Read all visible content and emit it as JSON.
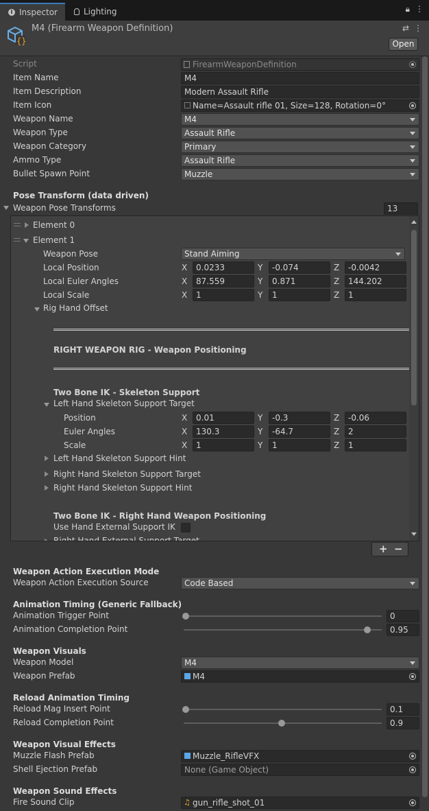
{
  "tabs": [
    {
      "label": "Inspector",
      "icon": "info-icon"
    },
    {
      "label": "Lighting",
      "icon": "bulb-icon"
    }
  ],
  "header": {
    "title": "M4 (Firearm Weapon Definition)",
    "open_label": "Open"
  },
  "fields": {
    "script": {
      "label": "Script",
      "value": "FirearmWeaponDefinition"
    },
    "item_name": {
      "label": "Item Name",
      "value": "M4"
    },
    "item_description": {
      "label": "Item Description",
      "value": "Modern Assault Rifle"
    },
    "item_icon": {
      "label": "Item Icon",
      "value": "Name=Assault rifle 01, Size=128, Rotation=0°"
    },
    "weapon_name": {
      "label": "Weapon Name",
      "value": "M4"
    },
    "weapon_type": {
      "label": "Weapon Type",
      "value": "Assault Rifle"
    },
    "weapon_category": {
      "label": "Weapon Category",
      "value": "Primary"
    },
    "ammo_type": {
      "label": "Ammo Type",
      "value": "Assault Rifle"
    },
    "bullet_spawn": {
      "label": "Bullet Spawn Point",
      "value": "Muzzle"
    }
  },
  "pose": {
    "section": "Pose Transform (data driven)",
    "list_label": "Weapon Pose Transforms",
    "count": "13",
    "element0": "Element 0",
    "element1": "Element 1",
    "weapon_pose_label": "Weapon Pose",
    "weapon_pose_value": "Stand Aiming",
    "local_position": {
      "label": "Local Position",
      "x": "0.0233",
      "y": "-0.074",
      "z": "-0.0042"
    },
    "local_euler": {
      "label": "Local Euler Angles",
      "x": "87.559",
      "y": "0.871",
      "z": "144.202"
    },
    "local_scale": {
      "label": "Local Scale",
      "x": "1",
      "y": "1",
      "z": "1"
    },
    "rig_hand_offset": "Rig Hand Offset",
    "rig_header": "RIGHT WEAPON RIG - Weapon Positioning",
    "two_bone_skel": "Two Bone IK - Skeleton Support",
    "left_target": "Left Hand Skeleton Support Target",
    "position": {
      "label": "Position",
      "x": "0.01",
      "y": "-0.3",
      "z": "-0.06"
    },
    "euler": {
      "label": "Euler Angles",
      "x": "130.3",
      "y": "-64.7",
      "z": "2"
    },
    "scale": {
      "label": "Scale",
      "x": "1",
      "y": "1",
      "z": "1"
    },
    "left_hint": "Left Hand Skeleton Support Hint",
    "right_target": "Right Hand Skeleton Support Target",
    "right_hint": "Right Hand Skeleton Support Hint",
    "two_bone_right": "Two Bone IK - Right Hand Weapon Positioning",
    "use_external": "Use Hand External Support IK",
    "right_external": "Right Hand External Support Target",
    "axis_x": "X",
    "axis_y": "Y",
    "axis_z": "Z",
    "add": "+",
    "remove": "−"
  },
  "action": {
    "section": "Weapon Action Execution Mode",
    "label": "Weapon Action Execution Source",
    "value": "Code Based"
  },
  "anim": {
    "section": "Animation Timing (Generic Fallback)",
    "trigger": {
      "label": "Animation Trigger Point",
      "value": "0",
      "fraction": 0
    },
    "completion": {
      "label": "Animation Completion Point",
      "value": "0.95",
      "fraction": 0.95
    }
  },
  "visuals": {
    "section": "Weapon Visuals",
    "model_label": "Weapon Model",
    "model_value": "M4",
    "prefab_label": "Weapon Prefab",
    "prefab_value": "M4"
  },
  "reload": {
    "section": "Reload Animation Timing",
    "insert": {
      "label": "Reload Mag Insert Point",
      "value": "0.1",
      "fraction": 0.0
    },
    "completion": {
      "label": "Reload Completion Point",
      "value": "0.9",
      "fraction": 0.5
    }
  },
  "vfx": {
    "section": "Weapon Visual Effects",
    "muzzle_label": "Muzzle Flash Prefab",
    "muzzle_value": "Muzzle_RifleVFX",
    "shell_label": "Shell Ejection Prefab",
    "shell_value": "None (Game Object)"
  },
  "sfx": {
    "section": "Weapon Sound Effects",
    "fire_label": "Fire Sound Clip",
    "fire_value": "gun_rifle_shot_01"
  },
  "colors": {
    "accent": "#3a79bb",
    "panel": "#383838"
  }
}
